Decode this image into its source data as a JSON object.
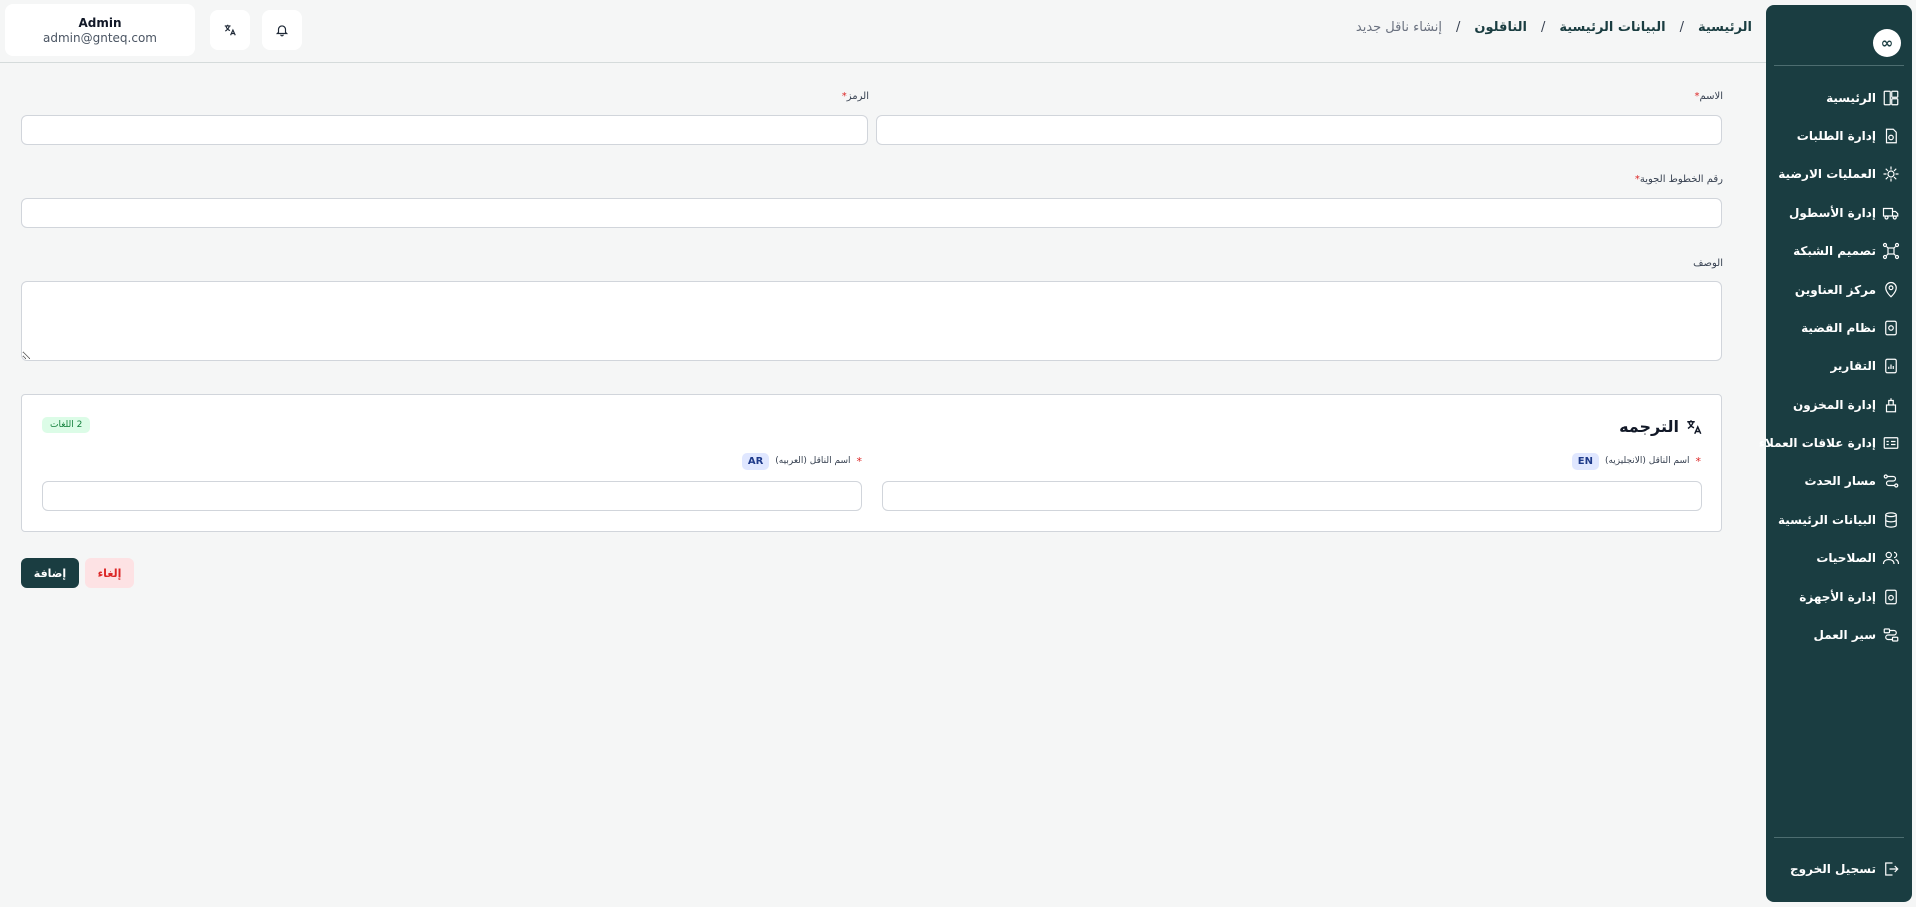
{
  "user": {
    "name": "Admin",
    "email": "admin@gnteq.com"
  },
  "icons": {
    "translate": "translate-icon",
    "notifications": "bell-icon",
    "logo": "infinity-logo"
  },
  "breadcrumb": {
    "home": "الرئيسية",
    "master_data": "البيانات الرئيسية",
    "carriers": "الناقلون",
    "current": "إنشاء ناقل جديد",
    "separator": "/"
  },
  "sidebar": {
    "logo": "∞",
    "items": [
      {
        "label": "الرئيسية",
        "icon": "layout-icon"
      },
      {
        "label": "إدارة الطلبات",
        "icon": "orders-icon"
      },
      {
        "label": "العمليات الارضية",
        "icon": "ground-ops-icon"
      },
      {
        "label": "إدارة الأسطول",
        "icon": "truck-icon"
      },
      {
        "label": "تصميم الشبكة",
        "icon": "network-icon"
      },
      {
        "label": "مركز العناوين",
        "icon": "location-icon"
      },
      {
        "label": "نظام القضية",
        "icon": "case-icon"
      },
      {
        "label": "التقارير",
        "icon": "reports-icon"
      },
      {
        "label": "إدارة المخزون",
        "icon": "inventory-icon"
      },
      {
        "label": "إدارة علاقات العملاء",
        "icon": "crm-icon"
      },
      {
        "label": "مسار الحدث",
        "icon": "event-path-icon"
      },
      {
        "label": "البيانات الرئيسية",
        "icon": "database-icon"
      },
      {
        "label": "الصلاحيات",
        "icon": "users-icon"
      },
      {
        "label": "إدارة الأجهزة",
        "icon": "device-icon"
      },
      {
        "label": "سير العمل",
        "icon": "workflow-icon"
      }
    ],
    "logout": {
      "label": "تسجيل الخروج",
      "icon": "logout-icon"
    }
  },
  "form": {
    "name_label": "الاسم",
    "code_label": "الرمز",
    "airline_number_label": "رقم الخطوط الجوية",
    "description_label": "الوصف",
    "required_mark": "*",
    "name_value": "",
    "code_value": "",
    "airline_number_value": "",
    "description_value": ""
  },
  "translation": {
    "title": "الترجمه",
    "languages_count": "2 اللغات",
    "en": {
      "badge": "EN",
      "label": "اسم الناقل (الانجليزيه)",
      "value": ""
    },
    "ar": {
      "badge": "AR",
      "label": "اسم الناقل (العربيه)",
      "value": ""
    }
  },
  "actions": {
    "add": "إضافة",
    "cancel": "إلغاء"
  },
  "colors": {
    "sidebar": "#1a3d41",
    "primary": "#1a3d41",
    "danger": "#dc2626",
    "success_bg": "#dcfce7"
  }
}
